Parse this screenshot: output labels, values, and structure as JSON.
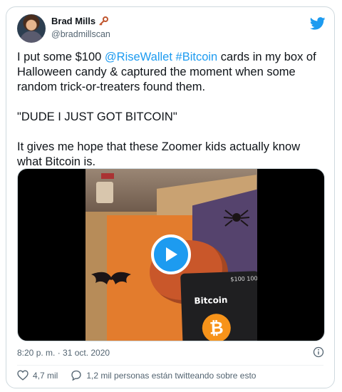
{
  "user": {
    "display_name": "Brad Mills",
    "handle": "@bradmillscan",
    "avatar_icon": "user-avatar",
    "badge_icon": "key-icon"
  },
  "tweet": {
    "text_line1_prefix": "I put some $100 ",
    "mention": "@RiseWallet",
    "hashtag": "#Bitcoin",
    "text_line1_suffix": " cards in my box of Halloween candy & captured the moment when some random trick-or-treaters found them.",
    "quote": "\"DUDE I JUST GOT BITCOIN\"",
    "closing": "It gives me hope that these Zoomer kids actually know what Bitcoin is."
  },
  "media": {
    "type": "video",
    "card_title": "Bitcoin",
    "card_value": "$100 100",
    "play_icon": "play-icon"
  },
  "meta": {
    "timestamp": "8:20 p. m. · 31 oct. 2020",
    "info_icon": "info-icon"
  },
  "actions": {
    "likes": "4,7 mil",
    "retweeters": "1,2 mil personas están twitteando sobre esto"
  },
  "colors": {
    "accent": "#1d9bf0",
    "text": "#0f1419",
    "muted": "#536471",
    "border": "#cfd9de"
  }
}
